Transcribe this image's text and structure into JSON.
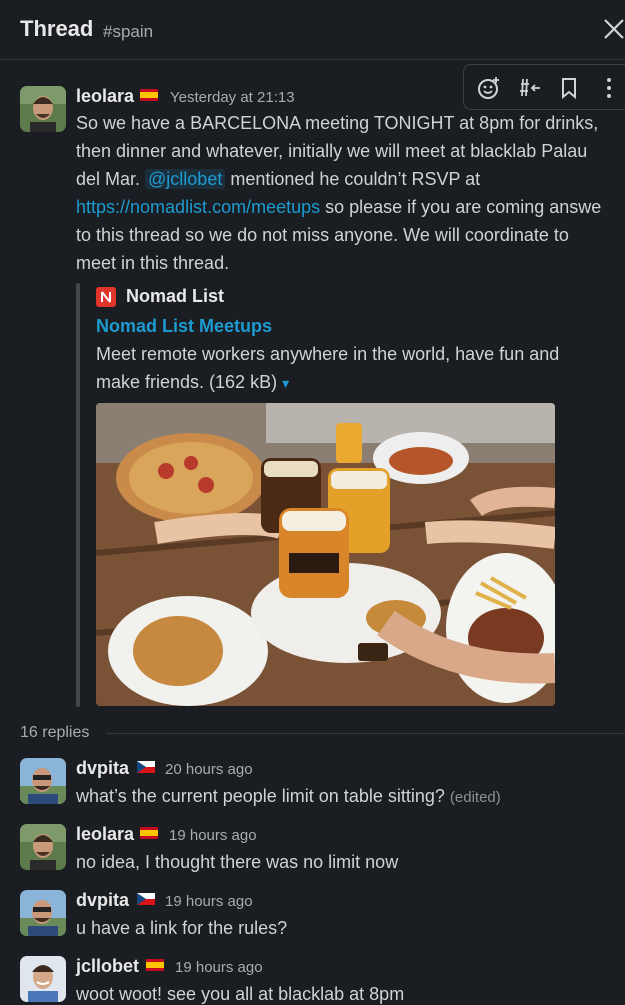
{
  "header": {
    "title": "Thread",
    "channel": "#spain"
  },
  "icons": {
    "close": "close-icon",
    "toolbar": [
      "add-reaction-icon",
      "share-channel-icon",
      "bookmark-icon",
      "more-vertical-icon"
    ]
  },
  "parent": {
    "user": "leolara",
    "flag": "spain-flag",
    "time": "Yesterday at 21:13",
    "lines": {
      "l1": "So we have a BARCELONA meeting TONIGHT at 8pm for drinks,",
      "l2": "then dinner and whatever, initially we will meet at blacklab Palau",
      "l3a": "del Mar. ",
      "l3_mention": "@jcllobet",
      "l3b": " mentioned he couldn’t RSVP at",
      "l4_link": "https://nomadlist.com/meetups",
      "l4b": " so please if you are coming answe",
      "l5": "to this thread so we do not miss anyone. We will coordinate to",
      "l6": "meet in this thread."
    },
    "attachment": {
      "site": "Nomad List",
      "title": "Nomad List Meetups",
      "desc1": "Meet remote workers anywhere in the world, have fun and",
      "desc2": "make friends. (162 kB)",
      "caret": "▾"
    }
  },
  "replies_label": "16 replies",
  "replies": [
    {
      "user": "dvpita",
      "flag": "czech-flag",
      "time": "20 hours ago",
      "text": "what’s the current people limit on table sitting?",
      "edited": "(edited)"
    },
    {
      "user": "leolara",
      "flag": "spain-flag",
      "time": "19 hours ago",
      "text": "no idea, I thought there was no limit now"
    },
    {
      "user": "dvpita",
      "flag": "czech-flag",
      "time": "19 hours ago",
      "text": "u have a link for the rules?"
    },
    {
      "user": "jcllobet",
      "flag": "spain-flag",
      "time": "19 hours ago",
      "text": "woot woot! see you all at blacklab at 8pm"
    }
  ],
  "colors": {
    "background": "#1a1d21",
    "link": "#1d9bd1",
    "text": "#d1d2d3",
    "muted": "#a9abae"
  }
}
